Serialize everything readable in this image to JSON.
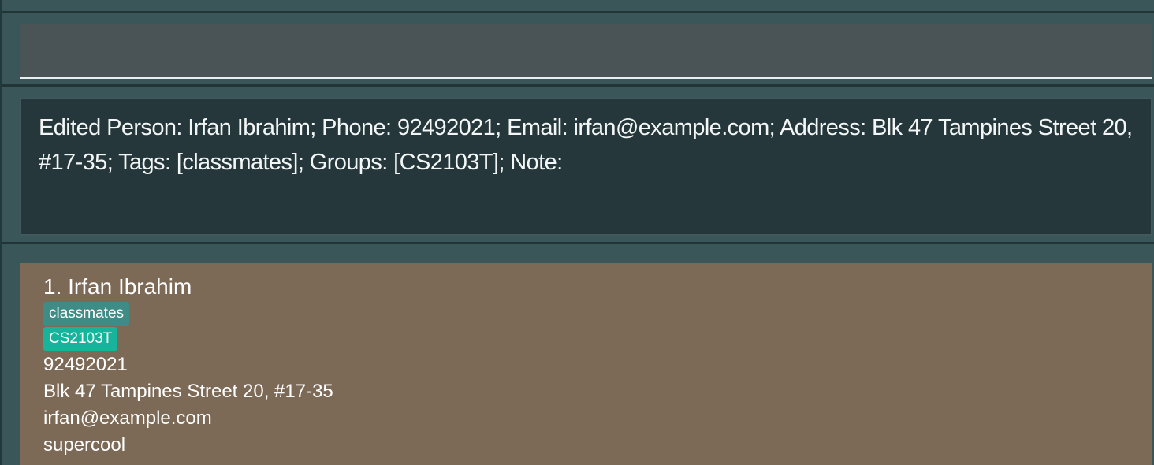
{
  "command_box": {
    "value": ""
  },
  "result_display": {
    "text": "Edited Person: Irfan Ibrahim; Phone: 92492021; Email: irfan@example.com; Address: Blk 47 Tampines Street 20, #17-35; Tags: [classmates]; Groups: [CS2103T]; Note:"
  },
  "person_list": [
    {
      "index_name": "1. Irfan Ibrahim",
      "tags": [
        "classmates"
      ],
      "groups": [
        "CS2103T"
      ],
      "phone": "92492021",
      "address": "Blk 47 Tampines Street 20, #17-35",
      "email": "irfan@example.com",
      "note": "supercool"
    }
  ],
  "colors": {
    "background": "#3a5658",
    "result_background": "#25373a",
    "card_background": "#7c6a57",
    "tag_color": "#3f8b86",
    "group_color": "#16b49a"
  }
}
